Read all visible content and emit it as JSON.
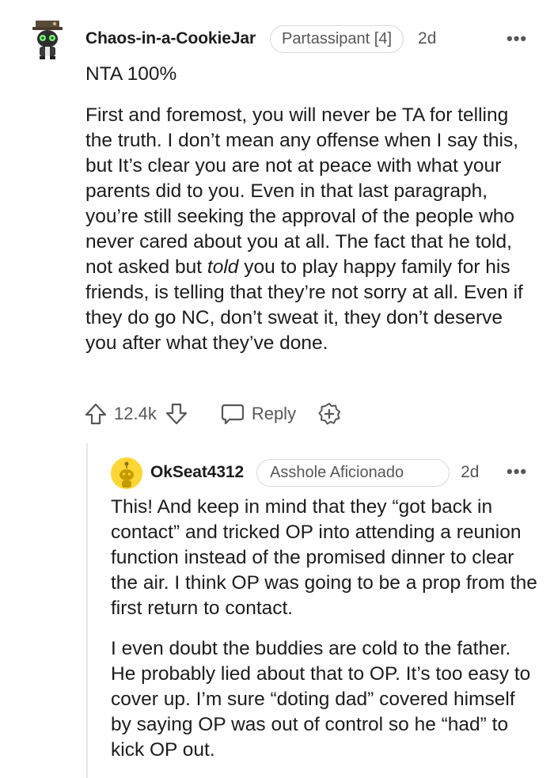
{
  "comment": {
    "username": "Chaos-in-a-CookieJar",
    "flair": "Partassipant [4]",
    "time": "2d",
    "more": "•••",
    "title_line": "NTA 100%",
    "paragraph_before_italic": "First and foremost, you will never be TA for telling the truth. I don’t mean any offense when I say this, but It’s clear you are not at peace with what your parents did to you. Even in that last paragraph, you’re still seeking the approval of the people who never cared about you at all. The fact that he told, not asked but ",
    "paragraph_italic": "told",
    "paragraph_after_italic": " you to play happy family for his friends, is telling that they’re not sorry at all. Even if they do go NC, don’t sweat it, they don’t deserve you after what they’ve done.",
    "vote_count": "12.4k",
    "reply_label": "Reply"
  },
  "reply": {
    "username": "OkSeat4312",
    "flair": "Asshole Aficionado",
    "time": "2d",
    "more": "•••",
    "paragraphs": [
      "This! And keep in mind that they “got back in contact” and tricked OP into attending a reunion function instead of the promised dinner to clear the air. I think OP was going to be a prop from the first return to contact.",
      "I even doubt the buddies are cold to the father. He probably lied about that to OP. It’s too easy to cover up. I’m sure “doting dad” covered himself by saying OP was out of control so he “had” to kick OP out."
    ]
  },
  "colors": {
    "text": "#1c1c1c",
    "meta": "#575757",
    "flair_border": "#d6d9dc",
    "thread_line": "#e5e7e9",
    "snoo_yellow": "#ffd635"
  },
  "icons": [
    "avatar-snoo-hat",
    "upvote-icon",
    "downvote-icon",
    "reply-bubble-icon",
    "award-plus-icon",
    "more-dots-icon"
  ]
}
